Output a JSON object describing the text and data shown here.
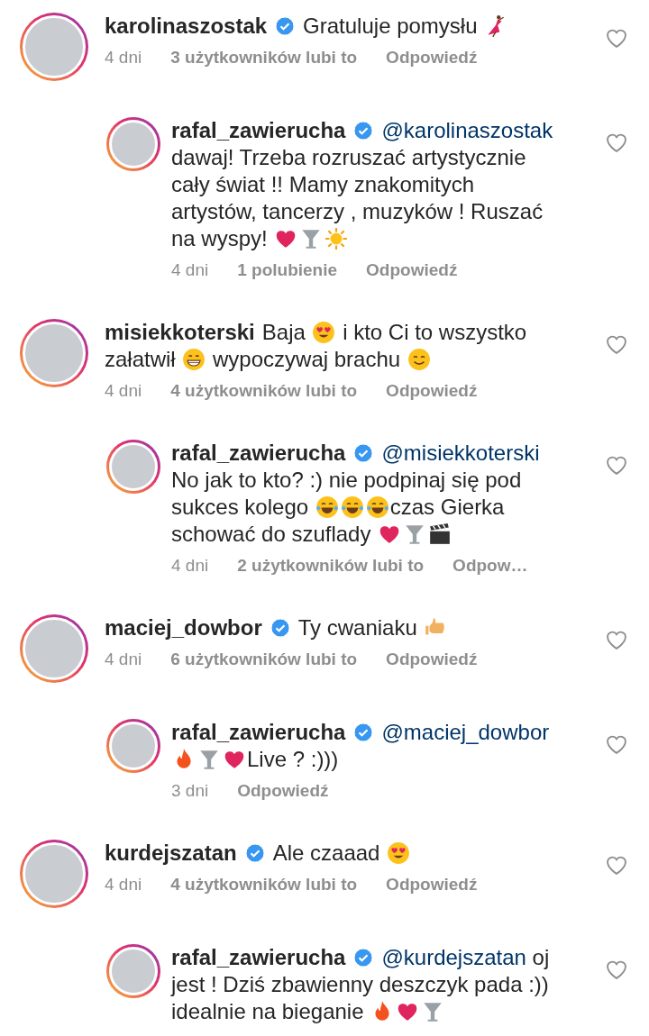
{
  "comments": [
    {
      "kind": "comment",
      "username": "karolinaszostak",
      "verified": true,
      "lines": [
        [
          {
            "kind": "text",
            "text": "Gratuluje pomysłu "
          },
          {
            "kind": "dancer"
          }
        ]
      ],
      "time": "4 dni",
      "likes": "3 użytkowników lubi to",
      "reply_label": "Odpowiedź"
    },
    {
      "kind": "reply",
      "username": "rafal_zawierucha",
      "verified": true,
      "lines": [
        [
          {
            "kind": "mention",
            "text": "@karolinaszostak"
          }
        ],
        [
          {
            "kind": "text",
            "text": "dawaj! Trzeba rozruszać artystycznie"
          }
        ],
        [
          {
            "kind": "text",
            "text": "cały świat !! Mamy znakomitych"
          }
        ],
        [
          {
            "kind": "text",
            "text": "artystów, tancerzy , muzyków ! Ruszać"
          }
        ],
        [
          {
            "kind": "text",
            "text": "na wyspy! "
          },
          {
            "kind": "heart"
          },
          {
            "kind": "cocktail"
          },
          {
            "kind": "sun"
          }
        ]
      ],
      "time": "4 dni",
      "likes": "1 polubienie",
      "reply_label": "Odpowiedź"
    },
    {
      "kind": "comment",
      "username": "misiekkoterski",
      "verified": false,
      "lines": [
        [
          {
            "kind": "text",
            "text": "Baja "
          },
          {
            "kind": "heart-eyes"
          },
          {
            "kind": "text",
            "text": " i kto Ci to wszystko"
          }
        ],
        [
          {
            "kind": "text",
            "text": "załatwił "
          },
          {
            "kind": "grin"
          },
          {
            "kind": "text",
            "text": " wypoczywaj brachu "
          },
          {
            "kind": "smile"
          }
        ]
      ],
      "time": "4 dni",
      "likes": "4 użytkowników lubi to",
      "reply_label": "Odpowiedź"
    },
    {
      "kind": "reply",
      "username": "rafal_zawierucha",
      "verified": true,
      "lines": [
        [
          {
            "kind": "mention",
            "text": "@misiekkoterski"
          }
        ],
        [
          {
            "kind": "text",
            "text": "No jak to kto? :) nie podpinaj się pod"
          }
        ],
        [
          {
            "kind": "text",
            "text": "sukces kolego "
          },
          {
            "kind": "laugh"
          },
          {
            "kind": "laugh"
          },
          {
            "kind": "laugh"
          },
          {
            "kind": "text",
            "text": "czas Gierka"
          }
        ],
        [
          {
            "kind": "text",
            "text": "schować do szuflady "
          },
          {
            "kind": "heart"
          },
          {
            "kind": "cocktail"
          },
          {
            "kind": "clapper"
          }
        ]
      ],
      "time": "4 dni",
      "likes": "2 użytkowników lubi to",
      "reply_label": "Odpow…"
    },
    {
      "kind": "comment",
      "username": "maciej_dowbor",
      "verified": true,
      "lines": [
        [
          {
            "kind": "text",
            "text": "Ty cwaniaku "
          },
          {
            "kind": "thumbs-up"
          }
        ]
      ],
      "time": "4 dni",
      "likes": "6 użytkowników lubi to",
      "reply_label": "Odpowiedź"
    },
    {
      "kind": "reply",
      "username": "rafal_zawierucha",
      "verified": true,
      "lines": [
        [
          {
            "kind": "mention",
            "text": "@maciej_dowbor"
          }
        ],
        [
          {
            "kind": "fire"
          },
          {
            "kind": "cocktail"
          },
          {
            "kind": "heart"
          },
          {
            "kind": "text",
            "text": "Live ? :)))"
          }
        ]
      ],
      "time": "3 dni",
      "reply_label": "Odpowiedź"
    },
    {
      "kind": "comment",
      "username": "kurdejszatan",
      "verified": true,
      "lines": [
        [
          {
            "kind": "text",
            "text": "Ale czaaad "
          },
          {
            "kind": "heart-eyes"
          }
        ]
      ],
      "time": "4 dni",
      "likes": "4 użytkowników lubi to",
      "reply_label": "Odpowiedź"
    },
    {
      "kind": "reply",
      "username": "rafal_zawierucha",
      "verified": true,
      "lines": [
        [
          {
            "kind": "mention",
            "text": "@kurdejszatan"
          },
          {
            "kind": "text",
            "text": " oj"
          }
        ],
        [
          {
            "kind": "text",
            "text": "jest ! Dziś zbawienny deszczyk pada :))"
          }
        ],
        [
          {
            "kind": "text",
            "text": "idealnie na bieganie "
          },
          {
            "kind": "fire"
          },
          {
            "kind": "heart"
          },
          {
            "kind": "cocktail"
          }
        ]
      ]
    }
  ]
}
